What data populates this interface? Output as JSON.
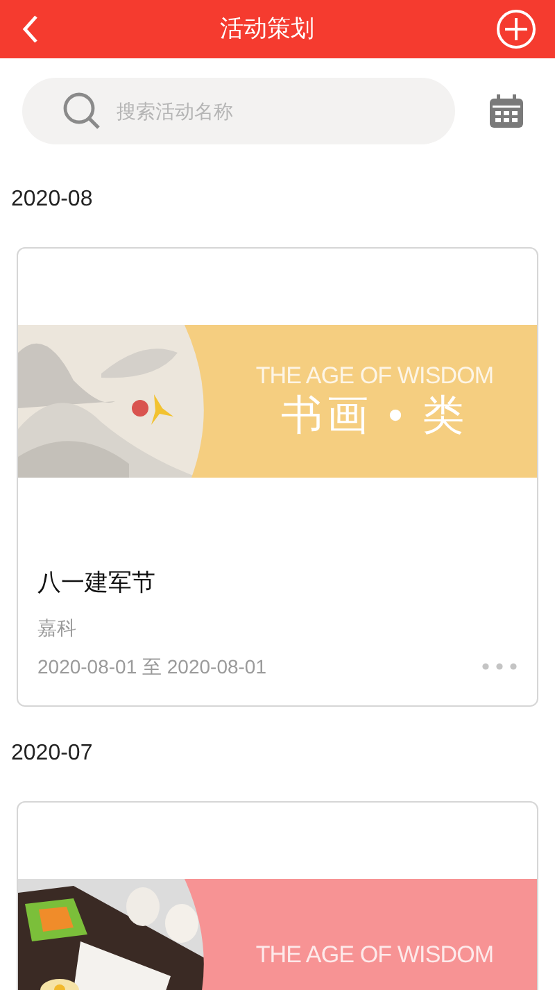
{
  "header": {
    "title": "活动策划"
  },
  "search": {
    "placeholder": "搜索活动名称"
  },
  "groups": [
    {
      "month": "2020-08",
      "activities": [
        {
          "banner": {
            "kind": "calligraphy",
            "color": "#f5ce80",
            "subtitle": "THE AGE OF WISDOM",
            "title": "书画 • 类"
          },
          "name": "八一建军节",
          "organizer": "嘉科",
          "dates": "2020-08-01 至 2020-08-01"
        }
      ]
    },
    {
      "month": "2020-07",
      "activities": [
        {
          "banner": {
            "kind": "food",
            "color": "#f79394",
            "subtitle": "THE AGE OF WISDOM"
          }
        }
      ]
    }
  ]
}
